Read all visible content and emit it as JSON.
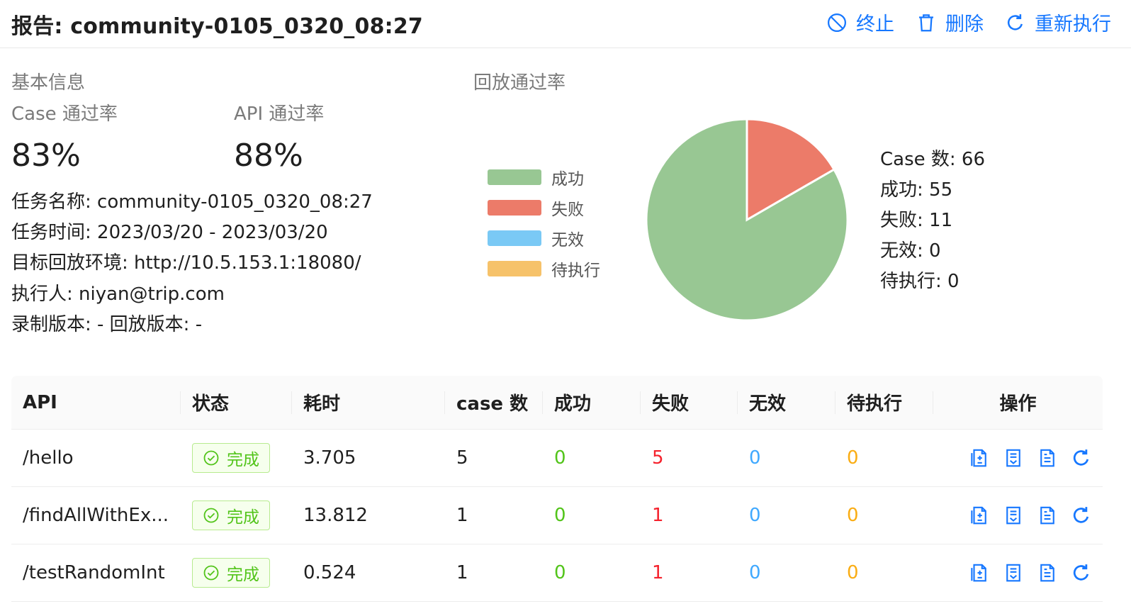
{
  "header": {
    "title": "报告: community-0105_0320_08:27",
    "stop_label": "终止",
    "delete_label": "删除",
    "rerun_label": "重新执行"
  },
  "basic": {
    "section_title": "基本信息",
    "case_rate_label": "Case 通过率",
    "case_rate_value": "83%",
    "api_rate_label": "API 通过率",
    "api_rate_value": "88%",
    "task_name": "任务名称: community-0105_0320_08:27",
    "task_time": "任务时间: 2023/03/20 - 2023/03/20",
    "target_env": "目标回放环境: http://10.5.153.1:18080/",
    "executor": "执行人: niyan@trip.com",
    "versions": "录制版本: - 回放版本: -"
  },
  "replay": {
    "section_title": "回放通过率",
    "stat_case": "Case 数: 66",
    "stat_success": "成功: 55",
    "stat_fail": "失败: 11",
    "stat_invalid": "无效: 0",
    "stat_pending": "待执行: 0"
  },
  "chart_data": {
    "type": "pie",
    "categories": [
      "成功",
      "失败",
      "无效",
      "待执行"
    ],
    "values": [
      55,
      11,
      0,
      0
    ],
    "colors": [
      "#98c793",
      "#ec7b69",
      "#7ac9f5",
      "#f6c26a"
    ],
    "legend_position": "left"
  },
  "table": {
    "headers": {
      "api": "API",
      "status": "状态",
      "time": "耗时",
      "case": "case 数",
      "success": "成功",
      "fail": "失败",
      "invalid": "无效",
      "pending": "待执行",
      "ops": "操作"
    },
    "rows": [
      {
        "api": "/hello",
        "status": "完成",
        "time": "3.705",
        "case": "5",
        "success": "0",
        "fail": "5",
        "invalid": "0",
        "pending": "0"
      },
      {
        "api": "/findAllWithEx...",
        "status": "完成",
        "time": "13.812",
        "case": "1",
        "success": "0",
        "fail": "1",
        "invalid": "0",
        "pending": "0"
      },
      {
        "api": "/testRandomInt",
        "status": "完成",
        "time": "0.524",
        "case": "1",
        "success": "0",
        "fail": "1",
        "invalid": "0",
        "pending": "0"
      }
    ],
    "op_icons": [
      "file-diff-icon",
      "diff-list-icon",
      "file-text-icon",
      "redo-icon"
    ]
  }
}
